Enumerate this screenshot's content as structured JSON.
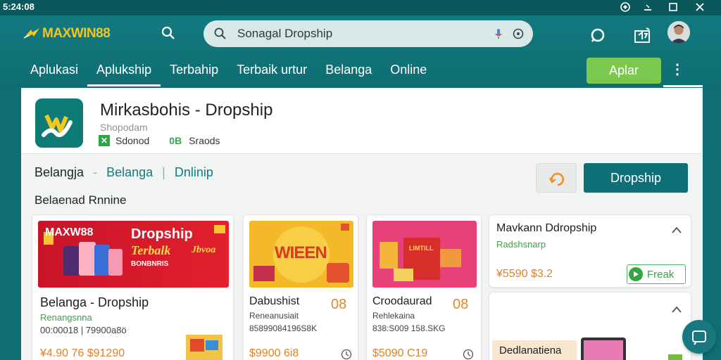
{
  "status": {
    "time": "5:24:08"
  },
  "header": {
    "brand": "MAXWIN88",
    "search": {
      "value": "Sonagal Dropship",
      "placeholder": "Sonagal Dropship"
    },
    "tabs": [
      "Aplukasi",
      "Aplukship",
      "Terbahip",
      "Terbaik urtur",
      "Belanga",
      "Online"
    ],
    "active_tab_index": 1,
    "apply_label": "Aplar",
    "more_label": "⋮"
  },
  "app": {
    "title": "Mirkasbohis - Dropship",
    "subtitle": "Shopodam",
    "badge1": "Sdonod",
    "badge1_icon": "✕",
    "badge2_prefix": "0B",
    "badge2": "Sraods"
  },
  "crumbs": {
    "c1": "Belangja",
    "sep1": "-",
    "c2": "Belanga",
    "sep2": "|",
    "c3": "Dnlinip"
  },
  "actions": {
    "dropship_label": "Dropship"
  },
  "section": {
    "title": "Belaenad Rnnine"
  },
  "cards": [
    {
      "banner_brand": "MAXW88",
      "banner_title": "Dropship",
      "banner_sub": "Terbalk",
      "banner_tag": "BONBNRIS",
      "banner_side": "Jbvoa",
      "title": "Belanga - Dropship",
      "green": "Renangsnna",
      "meta": "00:00018 | 79900a8ö",
      "price": "¥4.90 76",
      "price2": "$91290"
    },
    {
      "banner_title": "WIEEN",
      "title": "Dabushist",
      "num": "08",
      "meta_line1": "Reneanusiait",
      "meta": "85899084196S8K",
      "price": "$9900 6i8"
    },
    {
      "banner_title": "LIMTILL",
      "title": "Croodaurad",
      "num": "08",
      "meta_line1": "Rehlekaina",
      "meta": "838:S009 158.SKG",
      "price": "$5090 C19"
    },
    {
      "title": "Mavkann Ddropship",
      "green": "Radshsnarp",
      "price": "¥5590 $3.2",
      "peak_label": "Freak"
    },
    {
      "title": "Dedlanatiena"
    }
  ],
  "colors": {
    "teal": "#0f6e73",
    "green": "#7cc84e",
    "orange": "#e3872a",
    "gold": "#f4c51f"
  }
}
